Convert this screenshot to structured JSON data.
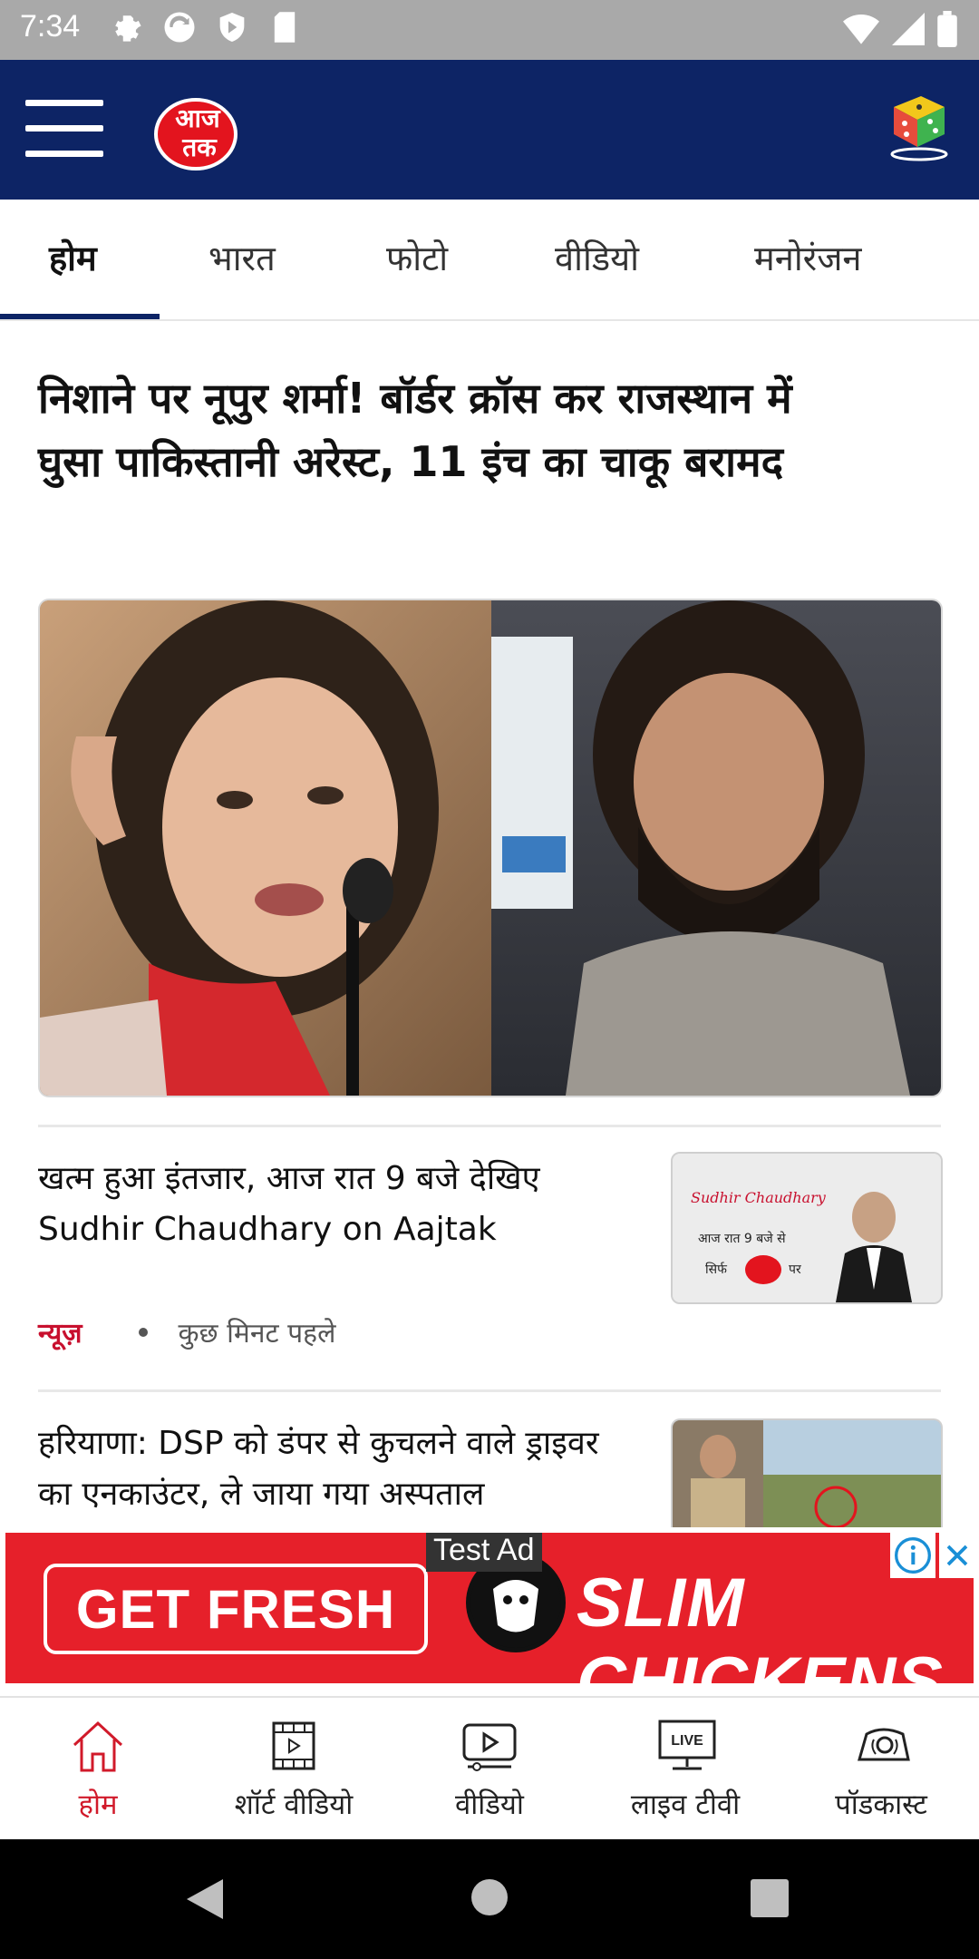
{
  "status_bar": {
    "time": "7:34"
  },
  "header": {
    "logo_text": "आज तक",
    "menu_icon": "hamburger-menu-icon",
    "game_icon": "dice-game-icon",
    "brand_color": "#0d2465"
  },
  "tabs": [
    {
      "label": "होम",
      "active": true
    },
    {
      "label": "भारत",
      "active": false
    },
    {
      "label": "फोटो",
      "active": false
    },
    {
      "label": "वीडियो",
      "active": false
    },
    {
      "label": "मनोरंजन",
      "active": false
    }
  ],
  "lead_story": {
    "title": "निशाने पर नूपुर शर्मा! बॉर्डर क्रॉस कर राजस्थान में घुसा पाकिस्तानी अरेस्ट, 11 इंच का चाकू बरामद"
  },
  "stories": [
    {
      "title": "खत्म हुआ इंतजार, आज रात 9 बजे देखिए Sudhir Chaudhary on Aajtak",
      "category": "न्यूज़",
      "time": "कुछ मिनट पहले",
      "thumb_text_1": "Sudhir Chaudhary",
      "thumb_text_2": "आज रात 9 बजे से",
      "thumb_text_3": "सिर्फ",
      "thumb_text_4": "पर"
    },
    {
      "title": "हरियाणा: DSP को डंपर से कुचलने वाले ड्राइवर का एनकाउंटर, ले जाया गया अस्पताल"
    }
  ],
  "ad": {
    "label": "Test Ad",
    "cta": "GET FRESH",
    "brand": "SLIM CHICKENS",
    "background": "#e6202a"
  },
  "bottom_nav": [
    {
      "label": "होम",
      "icon": "home-icon",
      "active": true
    },
    {
      "label": "शॉर्ट वीडियो",
      "icon": "short-video-icon",
      "active": false
    },
    {
      "label": "वीडियो",
      "icon": "video-play-icon",
      "active": false
    },
    {
      "label": "लाइव टीवी",
      "icon": "live-tv-icon",
      "active": false,
      "badge": "LIVE"
    },
    {
      "label": "पॉडकास्ट",
      "icon": "podcast-icon",
      "active": false
    }
  ],
  "colors": {
    "accent_red": "#d11a2a",
    "tab_underline": "#0d2465"
  }
}
